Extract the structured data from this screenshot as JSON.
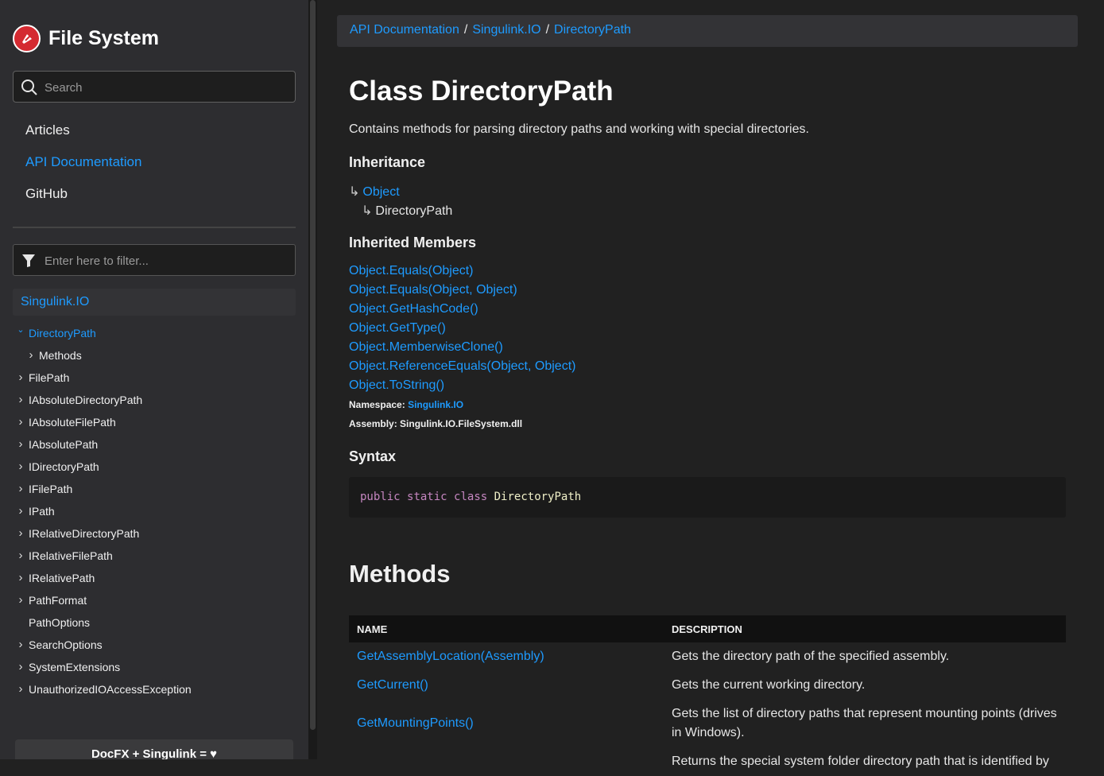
{
  "app": {
    "title": "File System"
  },
  "search": {
    "placeholder": "Search"
  },
  "nav": {
    "items": [
      "Articles",
      "API Documentation",
      "GitHub"
    ],
    "active_index": 1
  },
  "filter": {
    "placeholder": "Enter here to filter..."
  },
  "toc": {
    "namespace": "Singulink.IO",
    "items": [
      {
        "label": "DirectoryPath",
        "expanded": true,
        "active": true
      },
      {
        "label": "Methods",
        "child": true
      },
      {
        "label": "FilePath"
      },
      {
        "label": "IAbsoluteDirectoryPath"
      },
      {
        "label": "IAbsoluteFilePath"
      },
      {
        "label": "IAbsolutePath"
      },
      {
        "label": "IDirectoryPath"
      },
      {
        "label": "IFilePath"
      },
      {
        "label": "IPath"
      },
      {
        "label": "IRelativeDirectoryPath"
      },
      {
        "label": "IRelativeFilePath"
      },
      {
        "label": "IRelativePath"
      },
      {
        "label": "PathFormat"
      },
      {
        "label": "PathOptions",
        "no_chevron": true
      },
      {
        "label": "SearchOptions"
      },
      {
        "label": "SystemExtensions"
      },
      {
        "label": "UnauthorizedIOAccessException"
      }
    ]
  },
  "footer": {
    "text": "DocFX + Singulink = ♥"
  },
  "breadcrumb": {
    "items": [
      "API Documentation",
      "Singulink.IO",
      "DirectoryPath"
    ],
    "separator": "/"
  },
  "page": {
    "title": "Class DirectoryPath",
    "summary": "Contains methods for parsing directory paths and working with special directories.",
    "inheritance_heading": "Inheritance",
    "inheritance": [
      "Object",
      "DirectoryPath"
    ],
    "inherited_heading": "Inherited Members",
    "inherited_members": [
      "Object.Equals(Object)",
      "Object.Equals(Object, Object)",
      "Object.GetHashCode()",
      "Object.GetType()",
      "Object.MemberwiseClone()",
      "Object.ReferenceEquals(Object, Object)",
      "Object.ToString()"
    ],
    "namespace_label": "Namespace:",
    "namespace_value": "Singulink.IO",
    "assembly_label": "Assembly:",
    "assembly_value": "Singulink.IO.FileSystem.dll",
    "syntax_heading": "Syntax",
    "syntax": {
      "keywords": [
        "public",
        "static",
        "class"
      ],
      "name": "DirectoryPath"
    },
    "methods_heading": "Methods",
    "methods_table": {
      "headers": [
        "NAME",
        "DESCRIPTION"
      ],
      "rows": [
        {
          "name": "GetAssemblyLocation(Assembly)",
          "description": "Gets the directory path of the specified assembly."
        },
        {
          "name": "GetCurrent()",
          "description": "Gets the current working directory."
        },
        {
          "name": "GetMountingPoints()",
          "description": "Gets the list of directory paths that represent mounting points (drives in Windows)."
        },
        {
          "name": "",
          "description": "Returns the special system folder directory path that is identified by"
        }
      ]
    }
  },
  "colors": {
    "accent": "#1e9bff",
    "background": "#212121",
    "sidebar": "#2d2d30",
    "logo": "#d42a31"
  }
}
